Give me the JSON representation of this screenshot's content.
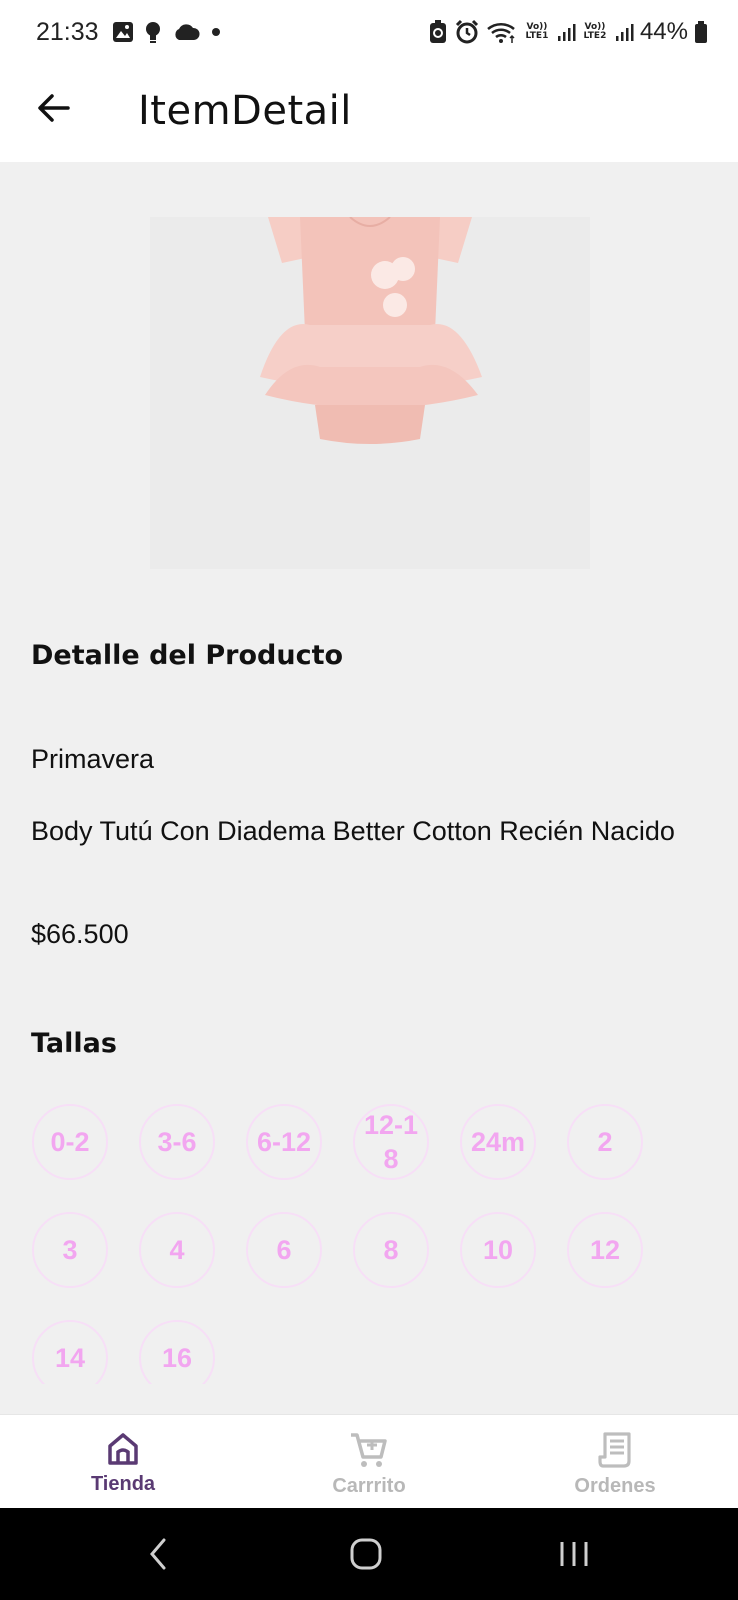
{
  "status_bar": {
    "time": "21:33",
    "net1": "Vo)) LTE1",
    "net2": "Vo)) LTE2",
    "battery": "44%"
  },
  "header": {
    "title": "ItemDetail",
    "back_icon": "arrow-left-icon"
  },
  "product": {
    "image_alt": "pink tutu bodysuit",
    "section_title": "Detalle del Producto",
    "category": "Primavera",
    "name": "Body Tutú Con Diadema Better Cotton Recién Nacido",
    "price": "$66.500"
  },
  "sizes": {
    "title": "Tallas",
    "options": [
      "0-2",
      "3-6",
      "6-12",
      "12-18",
      "24m",
      "2",
      "3",
      "4",
      "6",
      "8",
      "10",
      "12",
      "14",
      "16"
    ]
  },
  "bottom_nav": {
    "items": [
      {
        "label": "Tienda",
        "icon": "home-icon",
        "active": true
      },
      {
        "label": "Carrrito",
        "icon": "cart-icon",
        "active": false
      },
      {
        "label": "Ordenes",
        "icon": "receipt-icon",
        "active": false
      }
    ]
  },
  "colors": {
    "accent": "#5a3a73",
    "chip_text": "#f2a6f0",
    "chip_border": "#f7dff7",
    "background": "#f0f0f0"
  }
}
